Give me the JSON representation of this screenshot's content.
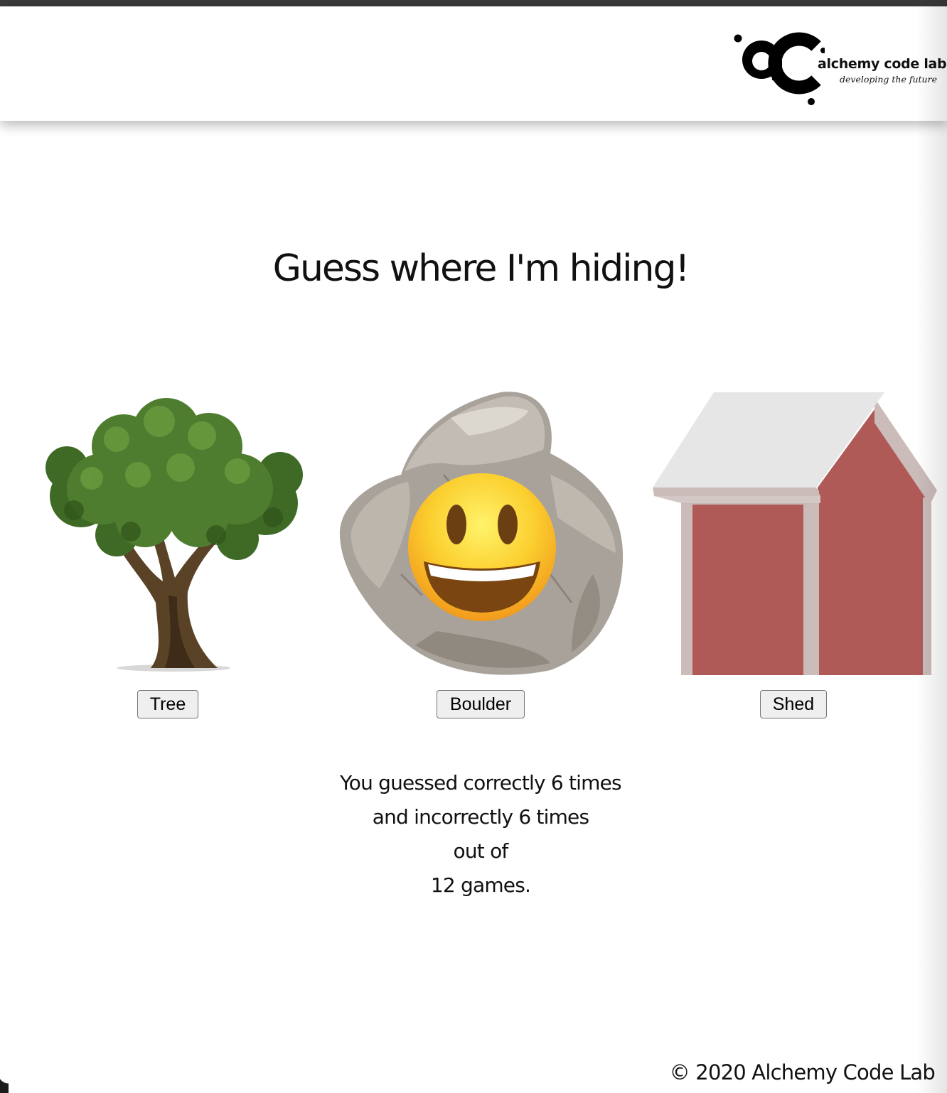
{
  "header": {
    "logo": {
      "mark": "ac",
      "name": "alchemy code lab",
      "tagline": "developing the future"
    }
  },
  "game": {
    "title": "Guess where I'm hiding!",
    "hiding_spot": "Boulder",
    "spots": [
      {
        "id": "tree",
        "label": "Tree",
        "image": "tree-image"
      },
      {
        "id": "boulder",
        "label": "Boulder",
        "image": "boulder-image",
        "has_face": true,
        "face": "grinning-face-emoji"
      },
      {
        "id": "shed",
        "label": "Shed",
        "image": "shed-image"
      }
    ]
  },
  "results": {
    "line1": "You guessed correctly 6 times",
    "line2": "and incorrectly 6 times",
    "line3": "out of",
    "line4": "12 games.",
    "correct": 6,
    "incorrect": 6,
    "total": 12
  },
  "footer": {
    "text": "© 2020 Alchemy Code Lab"
  },
  "colors": {
    "shed_red": "#b05a58",
    "shed_trim": "#cbbcba",
    "roof": "#e6e6e6",
    "tree_green": "#4a7a2c",
    "trunk": "#5a4226",
    "boulder": "#a8a29a",
    "emoji_yellow": "#fbcf2f",
    "button_bg": "#efefef"
  }
}
